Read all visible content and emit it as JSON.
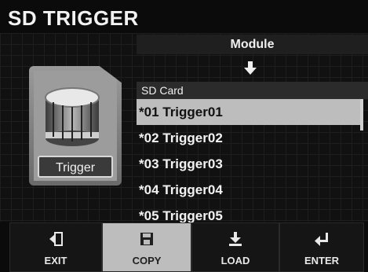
{
  "screen": {
    "title": "SD TRIGGER"
  },
  "card": {
    "label": "Trigger"
  },
  "panel": {
    "module_label": "Module",
    "sd_header": "SD Card",
    "items": [
      {
        "label": "*01 Trigger01",
        "selected": true
      },
      {
        "label": "*02 Trigger02",
        "selected": false
      },
      {
        "label": "*03 Trigger03",
        "selected": false
      },
      {
        "label": "*04 Trigger04",
        "selected": false
      },
      {
        "label": "*05 Trigger05",
        "selected": false
      }
    ]
  },
  "toolbar": {
    "buttons": [
      {
        "label": "EXIT",
        "icon": "exit-icon",
        "active": false
      },
      {
        "label": "COPY",
        "icon": "save-icon",
        "active": true
      },
      {
        "label": "LOAD",
        "icon": "download-icon",
        "active": false
      },
      {
        "label": "ENTER",
        "icon": "enter-icon",
        "active": false
      }
    ]
  },
  "colors": {
    "selected_row": "#bdbdbd",
    "active_button": "#bdbdbd",
    "background": "#0b0b0b"
  }
}
